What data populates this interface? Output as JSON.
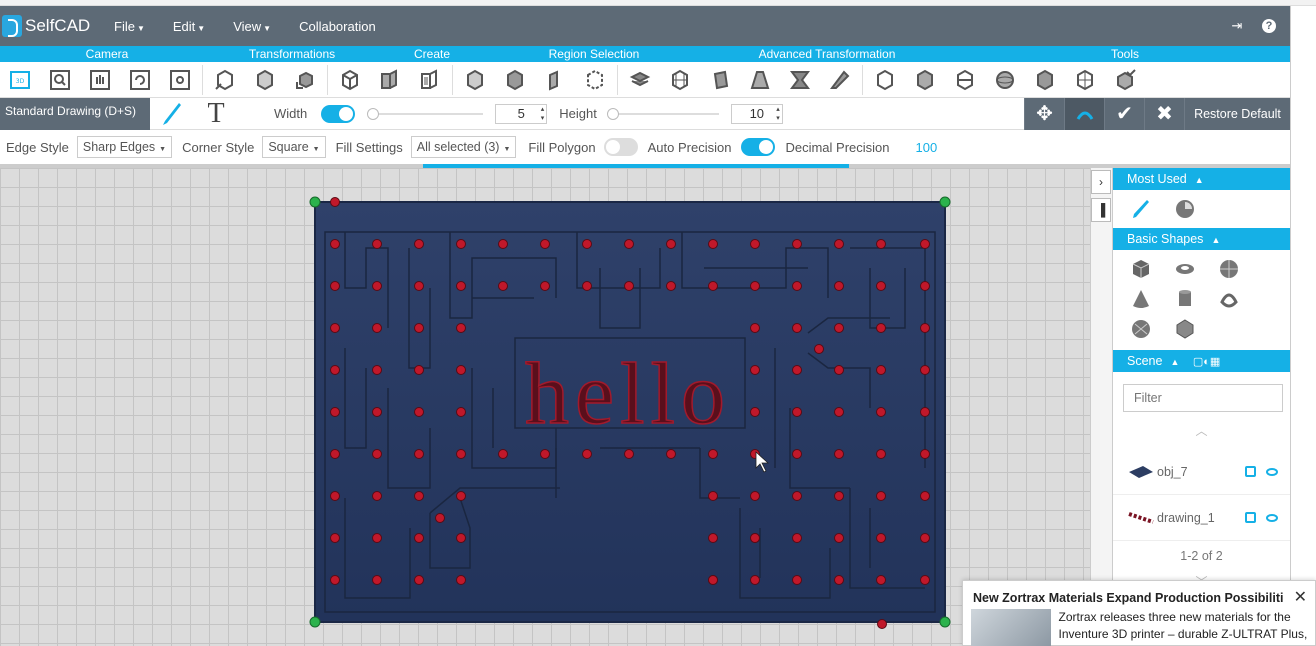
{
  "app": {
    "logo_text": "SelfCAD"
  },
  "menu": {
    "items": [
      "File",
      "Edit",
      "View",
      "Collaboration"
    ]
  },
  "categories": [
    "Camera",
    "Transformations",
    "Create",
    "Region Selection",
    "Advanced Transformation",
    "Tools"
  ],
  "drawing": {
    "mode": "Standard Drawing (D+S)",
    "width_label": "Width",
    "width_value": "5",
    "height_label": "Height",
    "height_value": "10",
    "restore_label": "Restore Default"
  },
  "edge": {
    "edge_style_label": "Edge Style",
    "edge_style_value": "Sharp Edges",
    "corner_style_label": "Corner Style",
    "corner_style_value": "Square",
    "fill_settings_label": "Fill Settings",
    "fill_settings_value": "All selected (3)",
    "fill_polygon_label": "Fill Polygon",
    "auto_precision_label": "Auto Precision",
    "decimal_precision_label": "Decimal Precision",
    "decimal_precision_value": "100"
  },
  "progress": {
    "fill_percent": 33
  },
  "viewport": {
    "text": "hello",
    "plate_color": "#2c3d62",
    "point_color": "#c0182a"
  },
  "panel": {
    "most_used": "Most Used",
    "basic_shapes": "Basic Shapes",
    "scene": "Scene",
    "filter_placeholder": "Filter",
    "items": [
      {
        "name": "obj_7"
      },
      {
        "name": "drawing_1"
      }
    ],
    "paging": "1-2 of 2"
  },
  "notification": {
    "title": "New Zortrax Materials Expand Production Possibilitie...",
    "body": "Zortrax releases three new materials for the Inventure 3D printer – durable Z-ULTRAT Plus,"
  },
  "colors": {
    "accent": "#15b0e6",
    "header": "#5d6a76"
  }
}
